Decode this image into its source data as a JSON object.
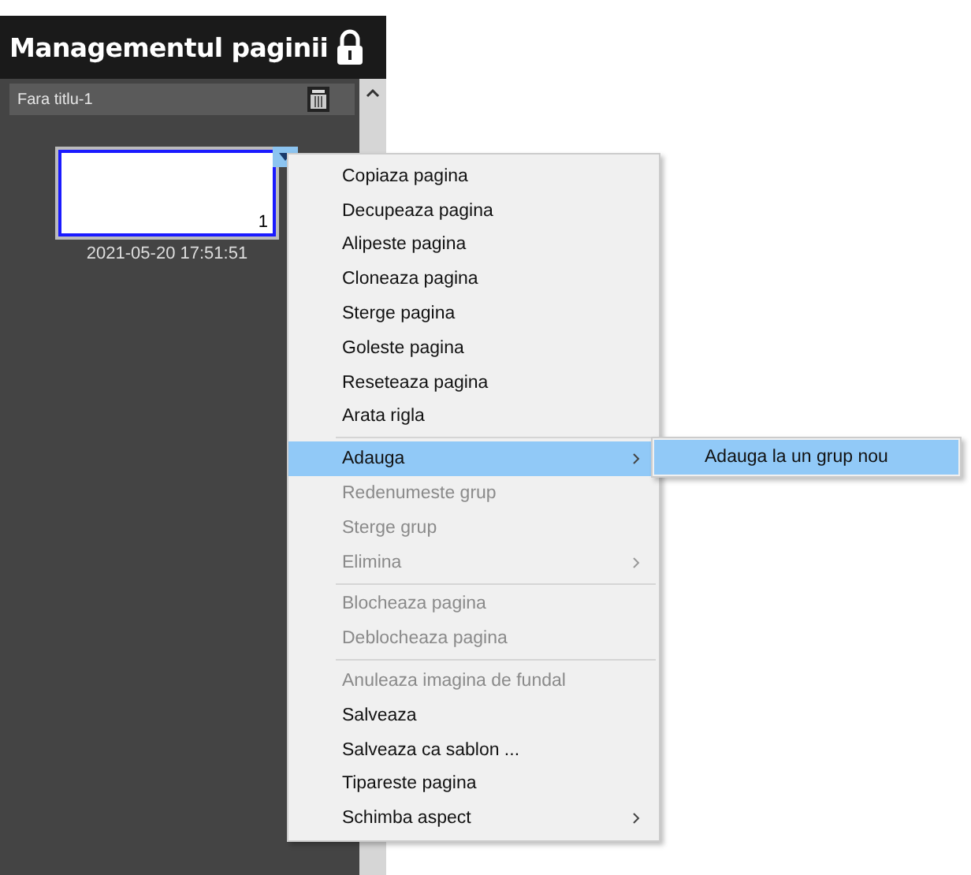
{
  "panel": {
    "title": "Managementul paginii",
    "locked": true,
    "group": {
      "name": "Fara titlu-1"
    },
    "pages": [
      {
        "number": "1",
        "timestamp": "2021-05-20 17:51:51",
        "selected": true
      }
    ]
  },
  "context_menu": {
    "items": [
      {
        "kind": "item",
        "label": "Copiaza pagina",
        "disabled": false,
        "selected": false,
        "submenu": false
      },
      {
        "kind": "item",
        "label": "Decupeaza pagina",
        "disabled": false,
        "selected": false,
        "submenu": false
      },
      {
        "kind": "item",
        "label": "Alipeste pagina",
        "disabled": false,
        "selected": false,
        "submenu": false
      },
      {
        "kind": "item",
        "label": "Cloneaza pagina",
        "disabled": false,
        "selected": false,
        "submenu": false
      },
      {
        "kind": "item",
        "label": "Sterge pagina",
        "disabled": false,
        "selected": false,
        "submenu": false
      },
      {
        "kind": "item",
        "label": "Goleste pagina",
        "disabled": false,
        "selected": false,
        "submenu": false
      },
      {
        "kind": "item",
        "label": "Reseteaza pagina",
        "disabled": false,
        "selected": false,
        "submenu": false
      },
      {
        "kind": "item",
        "label": "Arata rigla",
        "disabled": false,
        "selected": false,
        "submenu": false
      },
      {
        "kind": "separator"
      },
      {
        "kind": "item",
        "label": "Adauga",
        "disabled": false,
        "selected": true,
        "submenu": true
      },
      {
        "kind": "item",
        "label": "Redenumeste grup",
        "disabled": true,
        "selected": false,
        "submenu": false
      },
      {
        "kind": "item",
        "label": "Sterge grup",
        "disabled": true,
        "selected": false,
        "submenu": false
      },
      {
        "kind": "item",
        "label": "Elimina",
        "disabled": true,
        "selected": false,
        "submenu": true
      },
      {
        "kind": "separator"
      },
      {
        "kind": "item",
        "label": "Blocheaza pagina",
        "disabled": true,
        "selected": false,
        "submenu": false
      },
      {
        "kind": "item",
        "label": "Deblocheaza pagina",
        "disabled": true,
        "selected": false,
        "submenu": false
      },
      {
        "kind": "separator"
      },
      {
        "kind": "item",
        "label": "Anuleaza imagina de fundal",
        "disabled": true,
        "selected": false,
        "submenu": false
      },
      {
        "kind": "item",
        "label": "Salveaza",
        "disabled": false,
        "selected": false,
        "submenu": false
      },
      {
        "kind": "item",
        "label": "Salveaza ca sablon ...",
        "disabled": false,
        "selected": false,
        "submenu": false
      },
      {
        "kind": "item",
        "label": "Tipareste pagina",
        "disabled": false,
        "selected": false,
        "submenu": false
      },
      {
        "kind": "item",
        "label": "Schimba aspect",
        "disabled": false,
        "selected": false,
        "submenu": true
      }
    ]
  },
  "submenu": {
    "items": [
      {
        "label": "Adauga la un grup nou",
        "selected": true
      }
    ]
  }
}
